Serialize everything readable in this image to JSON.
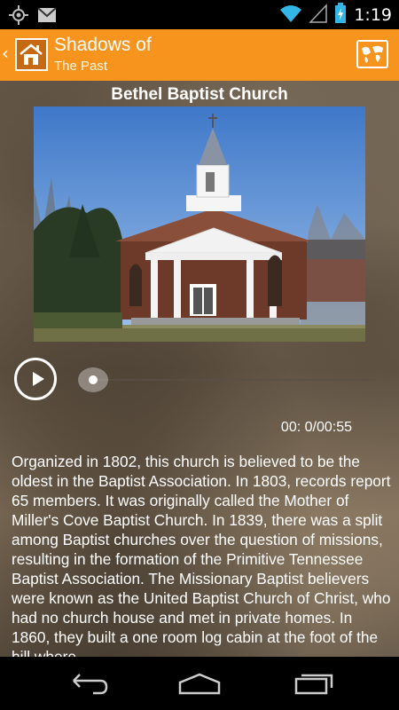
{
  "status_bar": {
    "time": "1:19",
    "icons": [
      "gps-icon",
      "gmail-icon",
      "wifi-icon",
      "signal-icon",
      "battery-charging-icon"
    ]
  },
  "action_bar": {
    "title_line1": "Shadows of",
    "title_line2": "The Past",
    "icons": [
      "app-logo-icon",
      "map-icon"
    ]
  },
  "content": {
    "place_title": "Bethel Baptist Church",
    "photo_subject": "Bethel Baptist Church building",
    "player": {
      "time_display": "00: 0/00:55",
      "progress": 0
    },
    "description": "Organized in 1802, this church is believed to be the oldest in the Baptist Association. In 1803, records report 65 members. It was originally called the Mother of Miller's Cove Baptist Church. In 1839, there was a split among Baptist churches over the question of missions, resulting in the formation of the Primitive Tennessee Baptist Association. The Missionary Baptist believers were known as the United Baptist Church of Christ, who had no church house and met in private homes. In 1860, they built a one room log cabin at the foot of the hill where"
  },
  "nav_bar": {
    "icons": [
      "back-icon",
      "home-icon",
      "recents-icon"
    ]
  },
  "colors": {
    "accent": "#f7941d",
    "status_icons": "#33b5e5"
  }
}
